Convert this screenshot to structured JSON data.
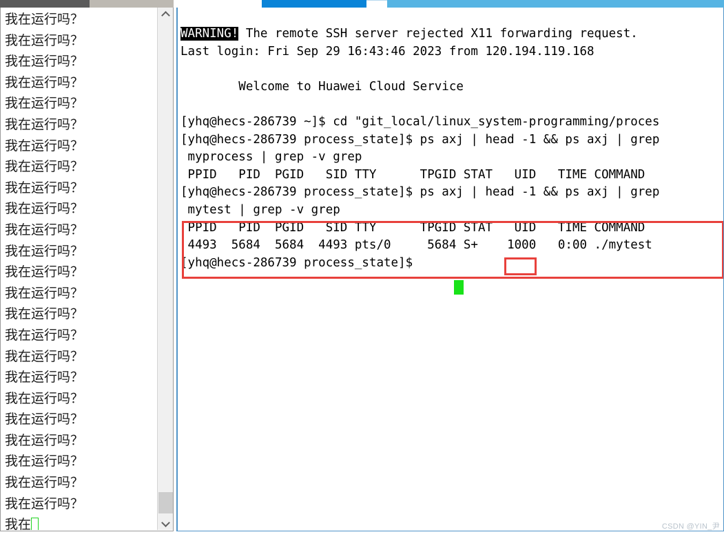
{
  "window": {
    "chrome": {
      "tab_dark_color": "#5a5a5a",
      "tab_gray_color": "#bdb9b2",
      "progress_blue_color": "#0a84d8",
      "progress_lightblue_color": "#56b4e3"
    }
  },
  "left_panel": {
    "name": "program-output-window",
    "line_text": "我在运行吗？",
    "line_count": 24,
    "last_partial_line": "我在",
    "cursor_color": "#1fd31f",
    "scrollbar": {
      "up_arrow": "▲",
      "down_arrow": "▼",
      "thumb_position": "near-bottom"
    }
  },
  "terminal": {
    "name": "ssh-terminal",
    "background": "#ffffff",
    "foreground": "#000000",
    "cursor_color": "#19e219",
    "lines": [
      {
        "id": "warning",
        "segments": [
          {
            "text": "WARNING!",
            "inverted": true
          },
          {
            "text": " The remote SSH server rejected X11 forwarding request.",
            "inverted": false
          }
        ]
      },
      {
        "id": "last-login",
        "segments": [
          {
            "text": "Last login: Fri Sep 29 16:43:46 2023 from 120.194.119.168",
            "inverted": false
          }
        ]
      },
      {
        "id": "blank-1",
        "segments": [
          {
            "text": "",
            "inverted": false
          }
        ]
      },
      {
        "id": "welcome",
        "segments": [
          {
            "text": "        Welcome to Huawei Cloud Service",
            "inverted": false
          }
        ]
      },
      {
        "id": "blank-2",
        "segments": [
          {
            "text": "",
            "inverted": false
          }
        ]
      },
      {
        "id": "cmd-cd",
        "segments": [
          {
            "text": "[yhq@hecs-286739 ~]$ cd \"git_local/linux_system-programming/proces",
            "inverted": false
          }
        ]
      },
      {
        "id": "cmd-ps-1",
        "segments": [
          {
            "text": "[yhq@hecs-286739 process_state]$ ps axj | head -1 && ps axj | grep",
            "inverted": false
          }
        ]
      },
      {
        "id": "cmd-ps-1-cont",
        "segments": [
          {
            "text": " myprocess | grep -v grep",
            "inverted": false
          }
        ]
      },
      {
        "id": "hdr-1",
        "segments": [
          {
            "text": " PPID   PID  PGID   SID TTY      TPGID STAT   UID   TIME COMMAND",
            "inverted": false
          }
        ]
      },
      {
        "id": "cmd-ps-2",
        "segments": [
          {
            "text": "[yhq@hecs-286739 process_state]$ ps axj | head -1 && ps axj | grep",
            "inverted": false
          }
        ]
      },
      {
        "id": "cmd-ps-2-cont",
        "segments": [
          {
            "text": " mytest | grep -v grep",
            "inverted": false
          }
        ]
      },
      {
        "id": "hdr-2",
        "segments": [
          {
            "text": " PPID   PID  PGID   SID TTY      TPGID STAT   UID   TIME COMMAND",
            "inverted": false
          }
        ]
      },
      {
        "id": "row-mytest",
        "segments": [
          {
            "text": " 4493  5684  5684  4493 pts/0     5684 S+    1000   0:00 ./mytest",
            "inverted": false
          }
        ]
      },
      {
        "id": "prompt-final",
        "segments": [
          {
            "text": "[yhq@hecs-286739 process_state]$ ",
            "inverted": false
          }
        ]
      }
    ],
    "ps_table": {
      "columns": [
        "PPID",
        "PID",
        "PGID",
        "SID",
        "TTY",
        "TPGID",
        "STAT",
        "UID",
        "TIME",
        "COMMAND"
      ],
      "rows": [
        [
          "4493",
          "5684",
          "5684",
          "4493",
          "pts/0",
          "5684",
          "S+",
          "1000",
          "0:00",
          "./mytest"
        ]
      ]
    },
    "annotations": [
      {
        "name": "highlight-ps-output",
        "color": "#e8413c",
        "target": "mytest ps output block"
      },
      {
        "name": "highlight-stat-value",
        "color": "#e8413c",
        "target": "S+"
      }
    ]
  },
  "watermark": {
    "text": "CSDN @YIN_尹"
  }
}
